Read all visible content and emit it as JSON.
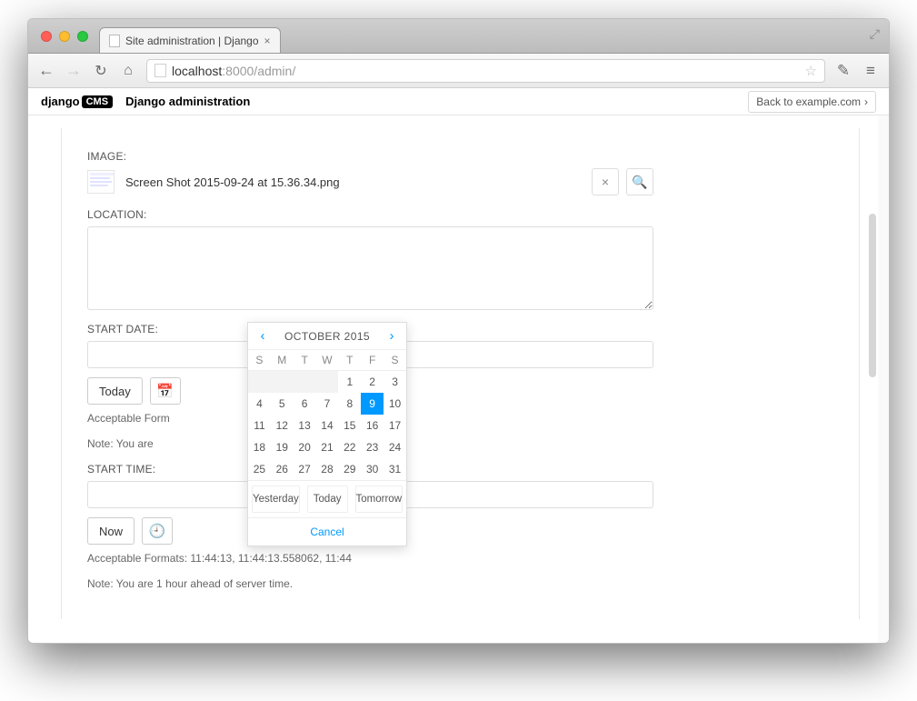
{
  "browser": {
    "tab_title": "Site administration | Django",
    "url_prefix": "localhost",
    "url_rest": ":8000/admin/"
  },
  "cmsbar": {
    "logo_left": "django",
    "logo_right": "CMS",
    "admin_title": "Django administration",
    "back_label": "Back to example.com"
  },
  "form": {
    "image_label": "IMAGE:",
    "image_filename": "Screen Shot 2015-09-24 at 15.36.34.png",
    "location_label": "LOCATION:",
    "start_date_label": "START DATE:",
    "today_label": "Today",
    "acceptable_formats_truncated": "Acceptable Form",
    "note_truncated_1": "Note: You are",
    "start_time_label": "START TIME:",
    "now_label": "Now",
    "acceptable_formats_time": "Acceptable Formats: 11:44:13, 11:44:13.558062, 11:44",
    "note_timezone": "Note: You are 1 hour ahead of server time."
  },
  "picker": {
    "title": "OCTOBER 2015",
    "dow": [
      "S",
      "M",
      "T",
      "W",
      "T",
      "F",
      "S"
    ],
    "weeks": [
      [
        "",
        "",
        "",
        "",
        "1",
        "2",
        "3"
      ],
      [
        "4",
        "5",
        "6",
        "7",
        "8",
        "9",
        "10"
      ],
      [
        "11",
        "12",
        "13",
        "14",
        "15",
        "16",
        "17"
      ],
      [
        "18",
        "19",
        "20",
        "21",
        "22",
        "23",
        "24"
      ],
      [
        "25",
        "26",
        "27",
        "28",
        "29",
        "30",
        "31"
      ]
    ],
    "selected_day": "9",
    "yesterday": "Yesterday",
    "today": "Today",
    "tomorrow": "Tomorrow",
    "cancel": "Cancel"
  }
}
